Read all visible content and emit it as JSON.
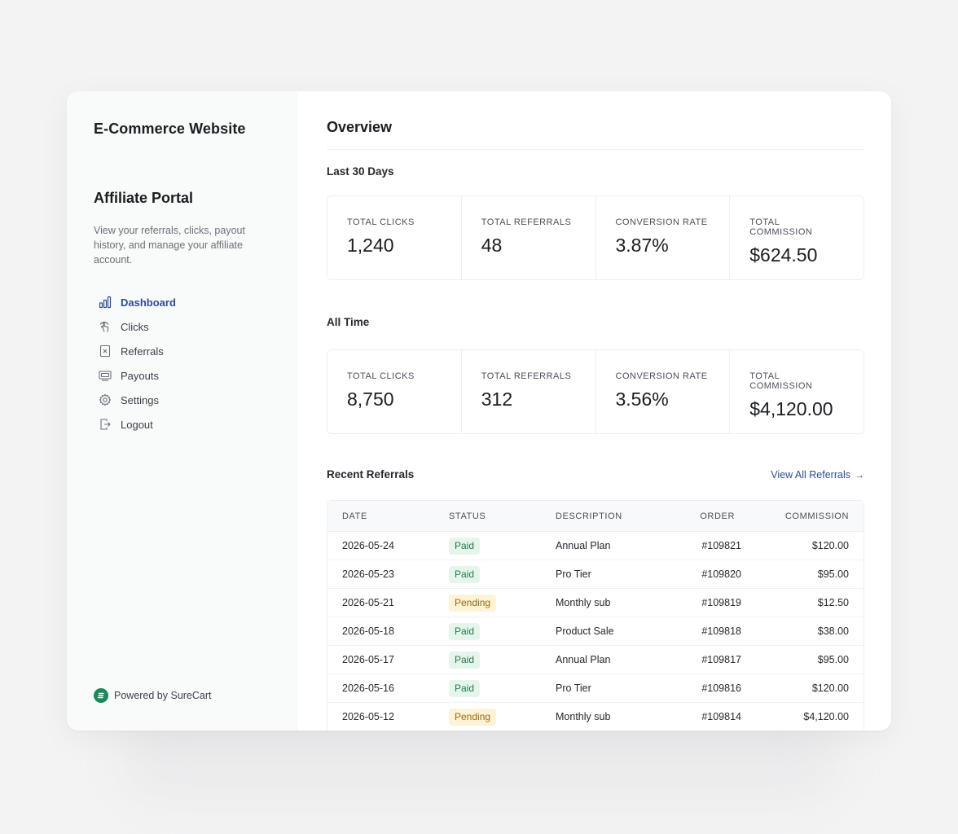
{
  "sidebar": {
    "site_title": "E-Commerce Website",
    "portal_title": "Affiliate Portal",
    "portal_description": "View your referrals, clicks, payout history, and manage your affiliate account.",
    "nav": [
      {
        "label": "Dashboard",
        "icon": "bar-chart-icon",
        "active": true
      },
      {
        "label": "Clicks",
        "icon": "pointer-click-icon",
        "active": false
      },
      {
        "label": "Referrals",
        "icon": "document-x-icon",
        "active": false
      },
      {
        "label": "Payouts",
        "icon": "payment-card-icon",
        "active": false
      },
      {
        "label": "Settings",
        "icon": "gear-icon",
        "active": false
      },
      {
        "label": "Logout",
        "icon": "logout-icon",
        "active": false
      }
    ],
    "powered_by": "Powered by SureCart",
    "powered_logo_icon": "surecart-logo-icon"
  },
  "main": {
    "title": "Overview",
    "last30": {
      "label": "Last 30 Days",
      "stats": [
        {
          "label": "TOTAL CLICKS",
          "value": "1,240"
        },
        {
          "label": "TOTAL REFERRALS",
          "value": "48"
        },
        {
          "label": "CONVERSION RATE",
          "value": "3.87%"
        },
        {
          "label": "TOTAL COMMISSION",
          "value": "$624.50"
        }
      ]
    },
    "alltime": {
      "label": "All Time",
      "stats": [
        {
          "label": "TOTAL CLICKS",
          "value": "8,750"
        },
        {
          "label": "TOTAL REFERRALS",
          "value": "312"
        },
        {
          "label": "CONVERSION RATE",
          "value": "3.56%"
        },
        {
          "label": "TOTAL COMMISSION",
          "value": "$4,120.00"
        }
      ]
    },
    "recent": {
      "label": "Recent Referrals",
      "view_all": "View All Referrals",
      "view_all_icon": "arrow-right-icon",
      "columns": [
        "DATE",
        "STATUS",
        "DESCRIPTION",
        "ORDER",
        "COMMISSION"
      ],
      "rows": [
        {
          "date": "2026-05-24",
          "status": "Paid",
          "description": "Annual Plan",
          "order": "#109821",
          "commission": "$120.00"
        },
        {
          "date": "2026-05-23",
          "status": "Paid",
          "description": "Pro Tier",
          "order": "#109820",
          "commission": "$95.00"
        },
        {
          "date": "2026-05-21",
          "status": "Pending",
          "description": "Monthly sub",
          "order": "#109819",
          "commission": "$12.50"
        },
        {
          "date": "2026-05-18",
          "status": "Paid",
          "description": "Product Sale",
          "order": "#109818",
          "commission": "$38.00"
        },
        {
          "date": "2026-05-17",
          "status": "Paid",
          "description": "Annual Plan",
          "order": "#109817",
          "commission": "$95.00"
        },
        {
          "date": "2026-05-16",
          "status": "Paid",
          "description": "Pro Tier",
          "order": "#109816",
          "commission": "$120.00"
        },
        {
          "date": "2026-05-12",
          "status": "Pending",
          "description": "Monthly sub",
          "order": "#109814",
          "commission": "$4,120.00"
        }
      ]
    }
  },
  "colors": {
    "accent": "#2b4c9b",
    "paid_bg": "#e6f5ec",
    "paid_text": "#1f7a4a",
    "pending_bg": "#fdf3d6",
    "pending_text": "#9a6a10",
    "brand_green": "#1b8a5a"
  }
}
